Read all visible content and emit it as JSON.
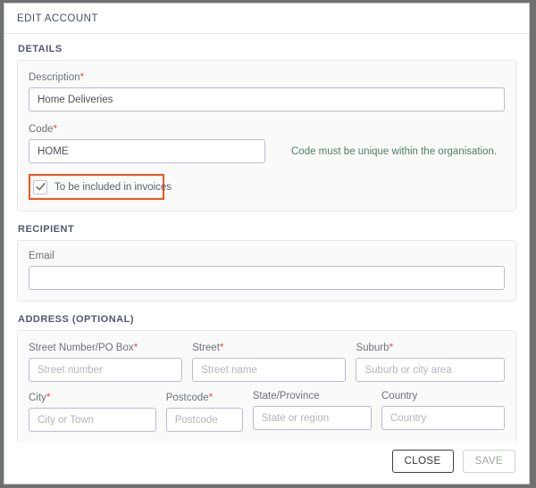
{
  "window": {
    "title": "EDIT ACCOUNT"
  },
  "sections": {
    "details": {
      "heading": "DETAILS",
      "description": {
        "label": "Description",
        "required": "*",
        "value": "Home Deliveries",
        "placeholder": ""
      },
      "code": {
        "label": "Code",
        "required": "*",
        "value": "HOME",
        "placeholder": "",
        "hint": "Code must be unique within the organisation."
      },
      "include_in_invoices": {
        "label": "To be included in invoices",
        "checked": true,
        "highlight_color": "#f1531a"
      }
    },
    "recipient": {
      "heading": "RECIPIENT",
      "email": {
        "label": "Email",
        "value": "",
        "placeholder": ""
      }
    },
    "address": {
      "heading": "ADDRESS (OPTIONAL)",
      "fields": [
        {
          "label": "Street Number/PO Box",
          "required": "*",
          "placeholder": "Street number",
          "value": ""
        },
        {
          "label": "Street",
          "required": "*",
          "placeholder": "Street name",
          "value": ""
        },
        {
          "label": "Suburb",
          "required": "*",
          "placeholder": "Suburb or city area",
          "value": ""
        },
        {
          "label": "City",
          "required": "*",
          "placeholder": "City or Town",
          "value": ""
        },
        {
          "label": "Postcode",
          "required": "*",
          "placeholder": "Postcode",
          "value": ""
        },
        {
          "label": "State/Province",
          "required": "",
          "placeholder": "State or region",
          "value": ""
        },
        {
          "label": "Country",
          "required": "",
          "placeholder": "Country",
          "value": ""
        }
      ]
    }
  },
  "footer": {
    "close_label": "CLOSE",
    "save_label": "SAVE"
  },
  "colors": {
    "hint_green": "#4e8161",
    "required_red": "#d9534f",
    "highlight_orange": "#f1531a"
  }
}
